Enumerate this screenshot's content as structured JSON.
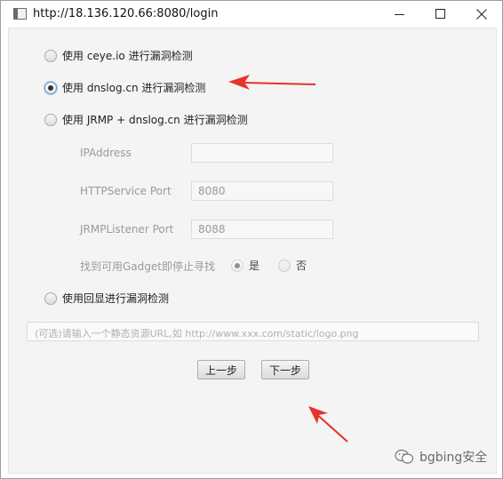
{
  "window": {
    "title": "http://18.136.120.66:8080/login"
  },
  "options": {
    "ceye": "使用 ceye.io 进行漏洞检测",
    "dnslog": "使用 dnslog.cn 进行漏洞检测",
    "jrmp": "使用 JRMP + dnslog.cn 进行漏洞检测",
    "echo": "使用回显进行漏洞检测"
  },
  "jrmp_fields": {
    "ip_label": "IPAddress",
    "ip_value": "",
    "http_label": "HTTPService Port",
    "http_value": "8080",
    "jrmp_label": "JRMPListener Port",
    "jrmp_value": "8088",
    "stop_label": "找到可用Gadget即停止寻找",
    "yes": "是",
    "no": "否"
  },
  "static_url": {
    "placeholder": "(可选)请输入一个静态资源URL,如 http://www.xxx.com/static/logo.png"
  },
  "buttons": {
    "prev": "上一步",
    "next": "下一步"
  },
  "watermark": {
    "text": "bgbing安全"
  },
  "selected_option": "dnslog",
  "colors": {
    "arrow": "#e8322a",
    "accent": "#6b9bd1"
  }
}
